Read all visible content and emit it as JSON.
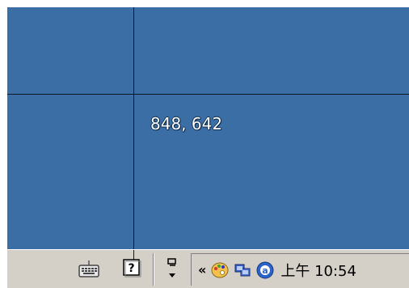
{
  "desktop": {
    "coordinate_readout": "848, 642"
  },
  "taskbar": {
    "tray": {
      "expand_label": "«",
      "clock": "上午 10:54"
    }
  },
  "icons": {
    "keyboard": "keyboard-icon",
    "help": "help-icon",
    "language": "language-switch-icon",
    "paint": "paint-icon",
    "network": "network-icon",
    "antivirus": "antivirus-icon"
  },
  "colors": {
    "desktop_bg": "#3b6ea5",
    "taskbar_bg": "#d4d0c8"
  }
}
